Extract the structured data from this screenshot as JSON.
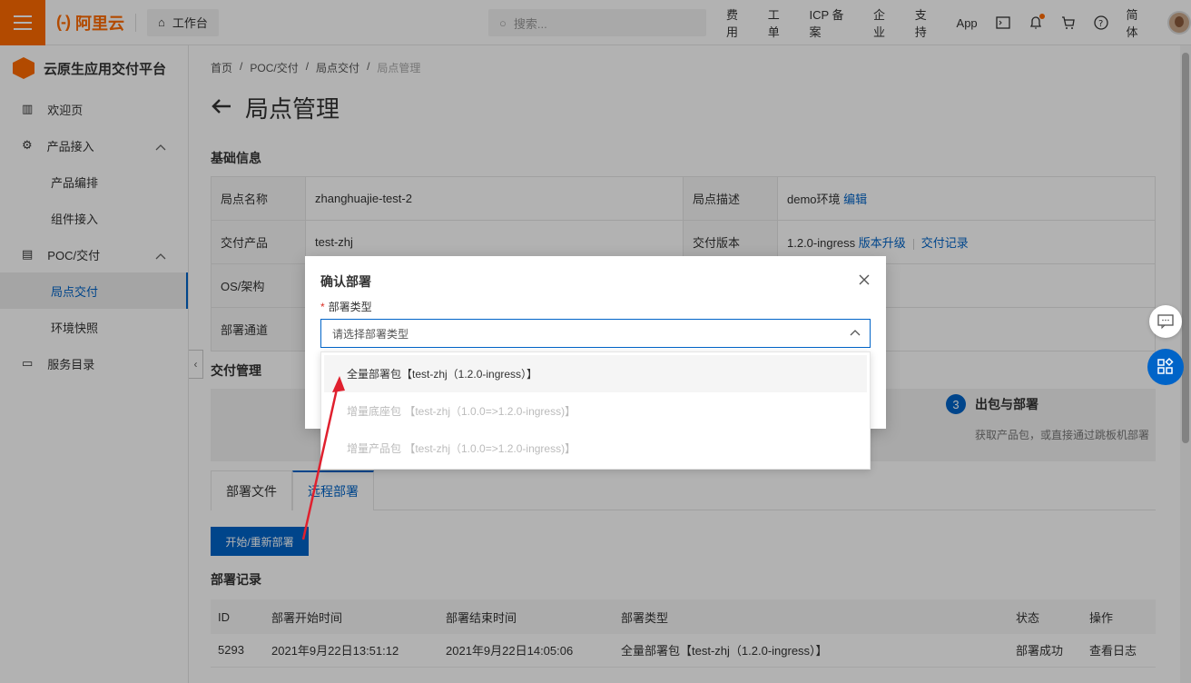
{
  "topbar": {
    "brand": "阿里云",
    "workbench": "工作台",
    "search_placeholder": "搜索...",
    "links": [
      "费用",
      "工单",
      "ICP 备案",
      "企业",
      "支持",
      "App"
    ],
    "lang": "简体"
  },
  "sidebar": {
    "title": "云原生应用交付平台",
    "items": [
      {
        "label": "欢迎页"
      },
      {
        "label": "产品接入"
      },
      {
        "label": "产品编排"
      },
      {
        "label": "组件接入"
      },
      {
        "label": "POC/交付"
      },
      {
        "label": "局点交付"
      },
      {
        "label": "环境快照"
      },
      {
        "label": "服务目录"
      }
    ]
  },
  "breadcrumb": [
    "首页",
    "POC/交付",
    "局点交付",
    "局点管理"
  ],
  "page_title": "局点管理",
  "basic_info": {
    "title": "基础信息",
    "rows": [
      {
        "l1": "局点名称",
        "v1": "zhanghuajie-test-2",
        "l2": "局点描述",
        "v2": "demo环境",
        "a2": [
          "编辑"
        ]
      },
      {
        "l1": "交付产品",
        "v1": "test-zhj",
        "l2": "交付版本",
        "v2": "1.2.0-ingress",
        "a2": [
          "版本升级",
          "交付记录"
        ]
      },
      {
        "l1": "OS/架构",
        "v1": "",
        "l2": "",
        "v2": ""
      },
      {
        "l1": "部署通道",
        "v1": "",
        "l2": "",
        "v2": ""
      }
    ]
  },
  "delivery": {
    "title": "交付管理",
    "step3_num": "3",
    "step3_title": "出包与部署",
    "step3_desc": "获取产品包，或直接通过跳板机部署"
  },
  "tabs": [
    "部署文件",
    "远程部署"
  ],
  "deploy_button": "开始/重新部署",
  "records": {
    "title": "部署记录",
    "headers": [
      "ID",
      "部署开始时间",
      "部署结束时间",
      "部署类型",
      "状态",
      "操作"
    ],
    "rows": [
      [
        "5293",
        "2021年9月22日13:51:12",
        "2021年9月22日14:05:06",
        "全量部署包【test-zhj（1.2.0-ingress）】",
        "部署成功",
        "查看日志"
      ]
    ]
  },
  "modal": {
    "title": "确认部署",
    "field_label": "部署类型",
    "select_placeholder": "请选择部署类型",
    "options": [
      "全量部署包【test-zhj（1.2.0-ingress）】",
      "增量底座包 【test-zhj（1.0.0=>1.2.0-ingress)】",
      "增量产品包 【test-zhj（1.0.0=>1.2.0-ingress)】"
    ]
  },
  "colors": {
    "accent": "#0064c8",
    "brand": "#ff6a00",
    "annotation": "#e0202e"
  }
}
